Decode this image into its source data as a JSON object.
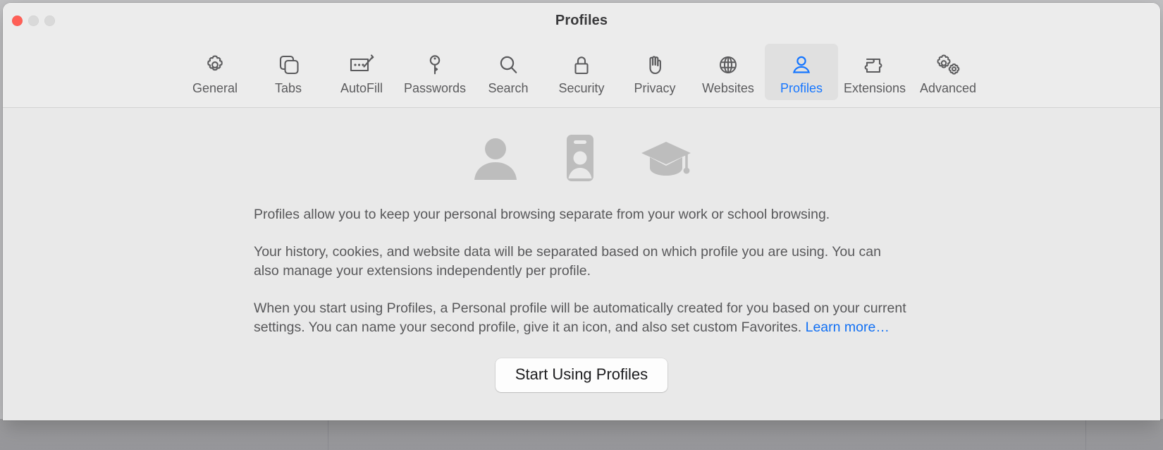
{
  "window": {
    "title": "Profiles",
    "controls": {
      "close": "close-button",
      "minimize": "minimize-button",
      "zoom": "zoom-button"
    }
  },
  "toolbar": {
    "items": [
      {
        "label": "General",
        "icon": "gear-icon",
        "selected": false
      },
      {
        "label": "Tabs",
        "icon": "tabs-icon",
        "selected": false
      },
      {
        "label": "AutoFill",
        "icon": "autofill-icon",
        "selected": false
      },
      {
        "label": "Passwords",
        "icon": "key-icon",
        "selected": false
      },
      {
        "label": "Search",
        "icon": "magnifier-icon",
        "selected": false
      },
      {
        "label": "Security",
        "icon": "lock-icon",
        "selected": false
      },
      {
        "label": "Privacy",
        "icon": "hand-icon",
        "selected": false
      },
      {
        "label": "Websites",
        "icon": "globe-icon",
        "selected": false
      },
      {
        "label": "Profiles",
        "icon": "person-icon",
        "selected": true
      },
      {
        "label": "Extensions",
        "icon": "puzzle-icon",
        "selected": false
      },
      {
        "label": "Advanced",
        "icon": "double-gear-icon",
        "selected": false
      }
    ],
    "selected_color": "#1676ff",
    "label_color": "#5b5b5d"
  },
  "content": {
    "hero_icons": [
      "person-silhouette-icon",
      "id-badge-icon",
      "graduation-cap-icon"
    ],
    "paragraphs": [
      "Profiles allow you to keep your personal browsing separate from your work or school browsing.",
      "Your history, cookies, and website data will be separated based on which profile you are using. You can also manage your extensions independently per profile."
    ],
    "paragraph3_text": "When you start using Profiles, a Personal profile will be automatically created for you based on your current settings. You can name your second profile, give it an icon, and also set custom Favorites. ",
    "learn_more_label": "Learn more…",
    "link_color": "#1170f4",
    "start_button_label": "Start Using Profiles",
    "text_color": "#58585a"
  }
}
